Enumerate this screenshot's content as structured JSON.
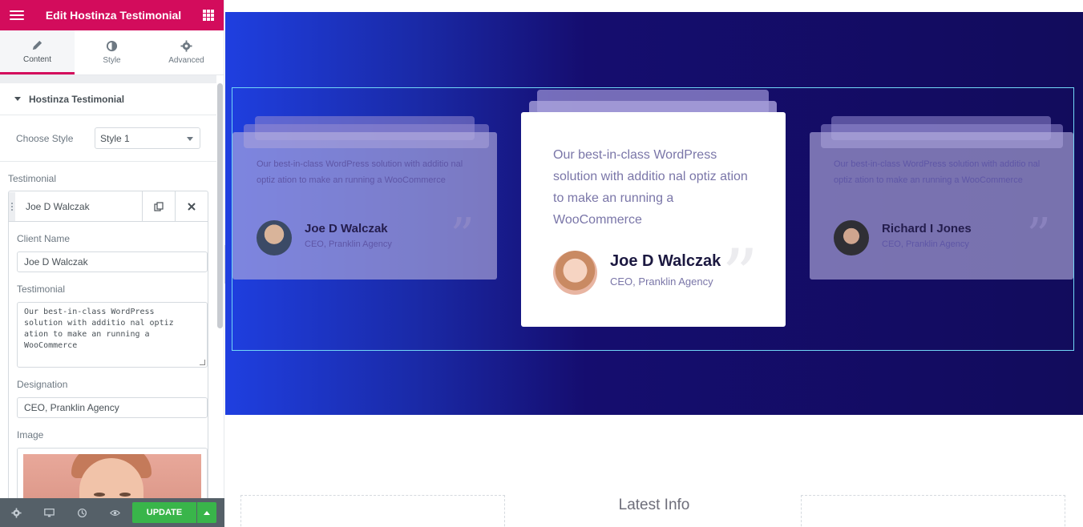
{
  "panel": {
    "title": "Edit Hostinza Testimonial",
    "tabs": [
      {
        "label": "Content",
        "icon": "pencil-icon"
      },
      {
        "label": "Style",
        "icon": "half-circle-icon"
      },
      {
        "label": "Advanced",
        "icon": "gear-icon"
      }
    ],
    "section_title": "Hostinza Testimonial",
    "choose_style": {
      "label": "Choose Style",
      "value": "Style 1"
    },
    "repeater_label": "Testimonial",
    "item": {
      "title": "Joe D Walczak",
      "client_name_label": "Client Name",
      "client_name_value": "Joe D Walczak",
      "testimonial_label": "Testimonial",
      "testimonial_value": "Our best-in-class WordPress\nsolution with additio nal optiz\nation to make an running a\nWooCommerce",
      "designation_label": "Designation",
      "designation_value": "CEO, Pranklin Agency",
      "image_label": "Image"
    },
    "footer": {
      "update_label": "UPDATE"
    }
  },
  "preview": {
    "cards": [
      {
        "quote": "Our best-in-class WordPress solution with additio nal optiz ation to make an running a WooCommerce",
        "name": "Joe D Walczak",
        "designation": "CEO, Pranklin Agency"
      },
      {
        "quote": "Our best-in-class WordPress solution with additio nal optiz ation to make an running a WooCommerce",
        "name": "Joe D Walczak",
        "designation": "CEO, Pranklin Agency"
      },
      {
        "quote": "Our best-in-class WordPress solution with additio nal optiz ation to make an running a WooCommerce",
        "name": "Richard I Jones",
        "designation": "CEO, Pranklin Agency"
      }
    ],
    "quote_mark": "”",
    "next_section_title": "Latest Info"
  },
  "colors": {
    "brand": "#d30c5c",
    "update": "#39b54a",
    "hero_start": "#1f3fe0",
    "hero_end": "#120c5c"
  }
}
